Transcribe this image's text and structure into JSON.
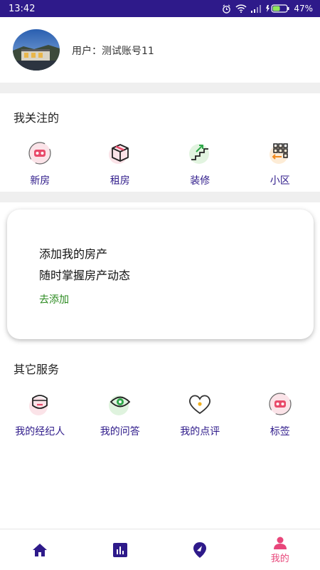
{
  "status_bar": {
    "time": "13:42",
    "battery": "47%"
  },
  "profile": {
    "username": "用户：测试账号11"
  },
  "following": {
    "title": "我关注的",
    "items": [
      {
        "label": "新房",
        "icon": "vr-headset-icon"
      },
      {
        "label": "租房",
        "icon": "box-icon"
      },
      {
        "label": "装修",
        "icon": "stairs-icon"
      },
      {
        "label": "小区",
        "icon": "grid-icon"
      }
    ]
  },
  "property_card": {
    "line1": "添加我的房产",
    "line2": "随时掌握房产动态",
    "link": "去添加"
  },
  "services": {
    "title": "其它服务",
    "items": [
      {
        "label": "我的经纪人",
        "icon": "agent-icon"
      },
      {
        "label": "我的问答",
        "icon": "eye-icon"
      },
      {
        "label": "我的点评",
        "icon": "heart-icon"
      },
      {
        "label": "标签",
        "icon": "tag-icon"
      }
    ]
  },
  "tabbar": {
    "active_label": "我的"
  },
  "colors": {
    "accent": "#2e1a8a",
    "active": "#e8467a",
    "link": "#2b8a1f"
  }
}
